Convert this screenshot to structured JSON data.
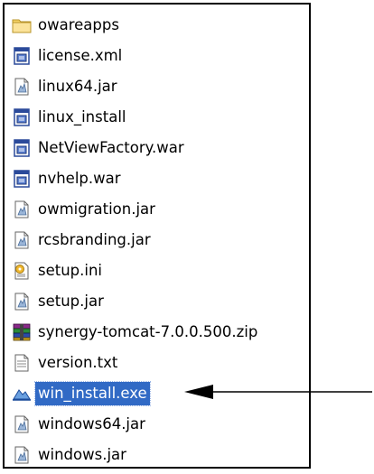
{
  "files": [
    {
      "name": "owareapps",
      "icon": "folder-icon"
    },
    {
      "name": "license.xml",
      "icon": "xml-file-icon"
    },
    {
      "name": "linux64.jar",
      "icon": "jar-file-icon"
    },
    {
      "name": "linux_install",
      "icon": "installer-file-icon"
    },
    {
      "name": "NetViewFactory.war",
      "icon": "war-file-icon"
    },
    {
      "name": "nvhelp.war",
      "icon": "war-file-icon"
    },
    {
      "name": "owmigration.jar",
      "icon": "jar-file-icon"
    },
    {
      "name": "rcsbranding.jar",
      "icon": "jar-file-icon"
    },
    {
      "name": "setup.ini",
      "icon": "ini-file-icon"
    },
    {
      "name": "setup.jar",
      "icon": "jar-file-icon"
    },
    {
      "name": "synergy-tomcat-7.0.0.500.zip",
      "icon": "zip-archive-icon"
    },
    {
      "name": "version.txt",
      "icon": "text-file-icon"
    },
    {
      "name": "win_install.exe",
      "icon": "exe-file-icon",
      "selected": true
    },
    {
      "name": "windows64.jar",
      "icon": "jar-file-icon"
    },
    {
      "name": "windows.jar",
      "icon": "jar-file-icon"
    }
  ],
  "colors": {
    "selection_bg": "#316ac5",
    "selection_text": "#ffffff",
    "folder": "#f5d266",
    "arrow": "#000000"
  }
}
